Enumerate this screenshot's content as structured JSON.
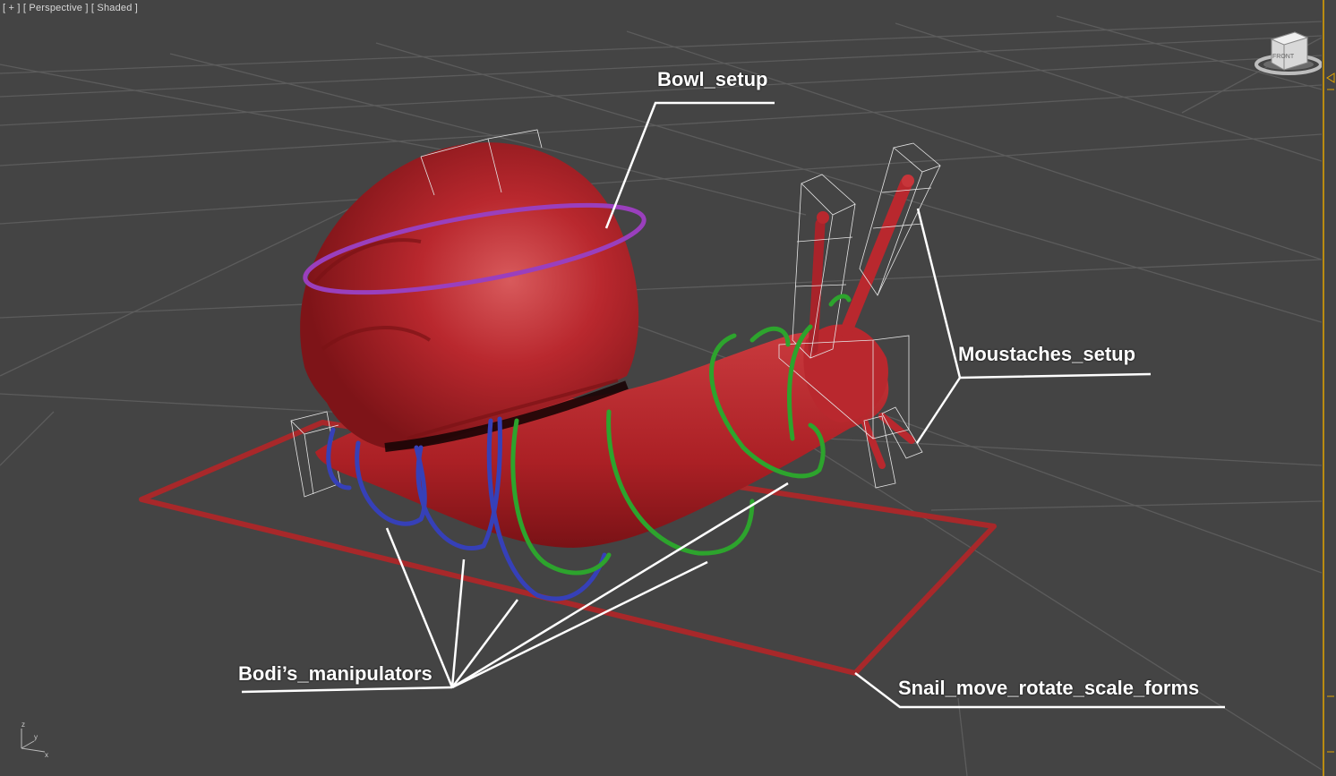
{
  "viewport": {
    "label_plus": "[ + ]",
    "label_view": "[ Perspective ]",
    "label_mode": "[ Shaded ]"
  },
  "viewcube": {
    "face_label": "FRONT"
  },
  "callouts": {
    "bowl": "Bowl_setup",
    "moustaches": "Moustaches_setup",
    "bodi": "Bodi’s_manipulators",
    "snail_move": "Snail_move_rotate_scale_forms"
  },
  "axis": {
    "z": "z",
    "y": "y",
    "x": "x"
  },
  "icons": [
    "viewcube-icon",
    "axis-tripod-icon",
    "time-slider-icon"
  ],
  "colors": {
    "background": "#444444",
    "grid": "#5e5e5e",
    "snail": "#b8262c",
    "bowl_ring": "#9a3fbd",
    "body_green": "#2da42d",
    "body_blue": "#3640b8",
    "move_frame": "#a8282a",
    "helper_boxes": "#e6e6e6",
    "callout_text": "#ffffff",
    "time_marker": "#e2a400"
  }
}
